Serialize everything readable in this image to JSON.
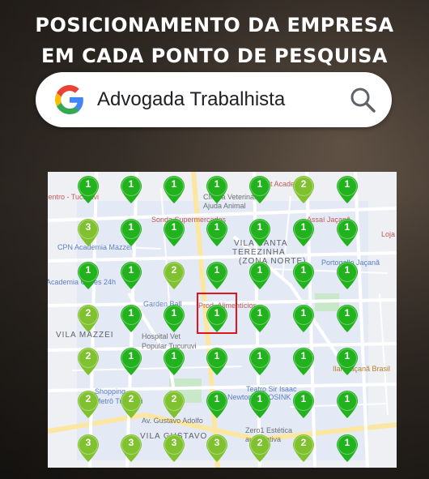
{
  "headline": {
    "line1": "POSICIONAMENTO DA EMPRESA",
    "line2": "EM CADA PONTO DE PESQUISA"
  },
  "search": {
    "logo_icon": "google-g-icon",
    "query": "Advogada Trabalhista",
    "button_icon": "magnifier-icon"
  },
  "colors": {
    "pin_dark_green": "#22b21d",
    "pin_light_green": "#80c12f",
    "highlight_red": "#e0141c"
  },
  "map": {
    "labels": [
      "Agit Academia",
      "Centro - Tucuruvi",
      "Clínica Veterinária",
      "Ajuda Animal",
      "Sonda Supermercados",
      "Assaí Jaçanã",
      "CPN Academia Mazzei",
      "VILA SANTA",
      "TEREZINHA",
      "(ZONA NORTE)",
      "Portogallo Jaçanã",
      "Academia Golfes 24h",
      "Garden Ball",
      "Prod. Alimentícios",
      "Loja Moda",
      "VILA MAZZEI",
      "Hospital Vet",
      "Popular Tucuruvi",
      "Shopping",
      "Metrô Tucuruvi",
      "Teatro Sir Isaac",
      "Newton - TROSINK",
      "Ilan Jaçanã Brasil",
      "Av. Gustavo Adolfo",
      "Zero1 Estética",
      "automotiva",
      "VILA GUSTAVO"
    ],
    "grid": [
      [
        1,
        1,
        1,
        1,
        1,
        2,
        1
      ],
      [
        3,
        1,
        1,
        1,
        1,
        1,
        1
      ],
      [
        1,
        1,
        2,
        1,
        1,
        1,
        1
      ],
      [
        2,
        1,
        1,
        1,
        1,
        1,
        1
      ],
      [
        2,
        1,
        1,
        1,
        1,
        1,
        1
      ],
      [
        2,
        2,
        2,
        1,
        1,
        1,
        1
      ],
      [
        3,
        3,
        3,
        3,
        2,
        2,
        1
      ]
    ],
    "highlighted_point": {
      "row": 3,
      "col": 3
    }
  }
}
